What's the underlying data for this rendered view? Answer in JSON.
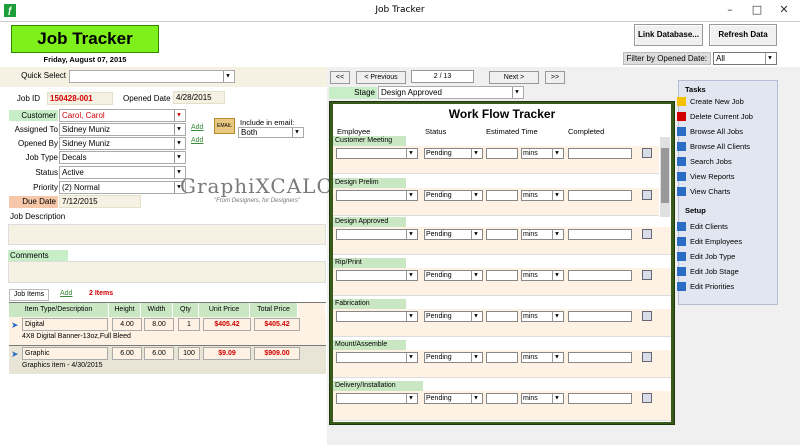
{
  "window": {
    "title": "Job Tracker",
    "app_icon": "ƒ"
  },
  "header": {
    "logo": "Job Tracker",
    "date": "Friday, August 07, 2015",
    "link_db": "Link Database...",
    "refresh": "Refresh Data",
    "filter_label": "Filter by Opened Date:",
    "filter_value": "All"
  },
  "form": {
    "quick_select_label": "Quick Select",
    "quick_select_value": "",
    "job_id_label": "Job ID",
    "job_id": "150428-001",
    "opened_date_label": "Opened Date",
    "opened_date": "4/28/2015",
    "customer_label": "Customer",
    "customer": "Carol, Carol",
    "assigned_to_label": "Assigned To",
    "assigned_to": "Sidney Muniz",
    "opened_by_label": "Opened By",
    "opened_by": "Sidney Muniz",
    "add": "Add",
    "include_email_label": "Include in email:",
    "include_email_value": "Both",
    "email_icon_label": "EMAIL",
    "job_type_label": "Job Type",
    "job_type": "Decals",
    "status_label": "Status",
    "status": "Active",
    "priority_label": "Priority",
    "priority": "(2) Normal",
    "due_date_label": "Due Date",
    "due_date": "7/12/2015",
    "job_description_label": "Job Description",
    "comments_label": "Comments"
  },
  "brand": {
    "name": "GraphiXCALC",
    "tagline": "\"From Designers, for Designers\""
  },
  "items": {
    "tab_label": "Job Items",
    "add": "Add",
    "count": "2 Items",
    "headers": [
      "Item Type/Description",
      "Height",
      "Width",
      "Qty",
      "Unit Price",
      "Total Price"
    ],
    "rows": [
      {
        "type": "Digital",
        "height": "4.00",
        "width": "8.00",
        "qty": "1",
        "unit": "$405.42",
        "total": "$405.42",
        "desc": "4X8 Digital Banner-13oz,Full Bleed"
      },
      {
        "type": "Graphic",
        "height": "6.00",
        "width": "6.00",
        "qty": "100",
        "unit": "$9.09",
        "total": "$909.00",
        "desc": "Graphics item - 4/30/2015"
      }
    ]
  },
  "nav": {
    "first": "<<",
    "prev": "< Previous",
    "position": "2 / 13",
    "next": "Next >",
    "last": ">>",
    "stage_label": "Stage",
    "stage_value": "Design Approved"
  },
  "workflow": {
    "title": "Work Flow Tracker",
    "col_employee": "Employee",
    "col_status": "Status",
    "col_time": "Estimated Time",
    "col_completed": "Completed",
    "stages": [
      {
        "name": "Customer Meeting",
        "status": "Pending",
        "unit": "mins"
      },
      {
        "name": "Design Prelim",
        "status": "Pending",
        "unit": "mins"
      },
      {
        "name": "Design Approved",
        "status": "Pending",
        "unit": "mins"
      },
      {
        "name": "Rip/Print",
        "status": "Pending",
        "unit": "mins"
      },
      {
        "name": "Fabrication",
        "status": "Pending",
        "unit": "mins"
      },
      {
        "name": "Mount/Assemble",
        "status": "Pending",
        "unit": "mins"
      },
      {
        "name": "Delivery/Installation",
        "status": "Pending",
        "unit": "mins"
      }
    ]
  },
  "tasks": {
    "title": "Tasks",
    "items": [
      "Create New Job",
      "Delete Current Job",
      "Browse All Jobs",
      "Browse All Clients",
      "Search Jobs",
      "View Reports",
      "View Charts"
    ],
    "setup_title": "Setup",
    "setup_items": [
      "Edit Clients",
      "Edit Employees",
      "Edit Job Type",
      "Edit Job Stage",
      "Edit Priorities"
    ]
  }
}
